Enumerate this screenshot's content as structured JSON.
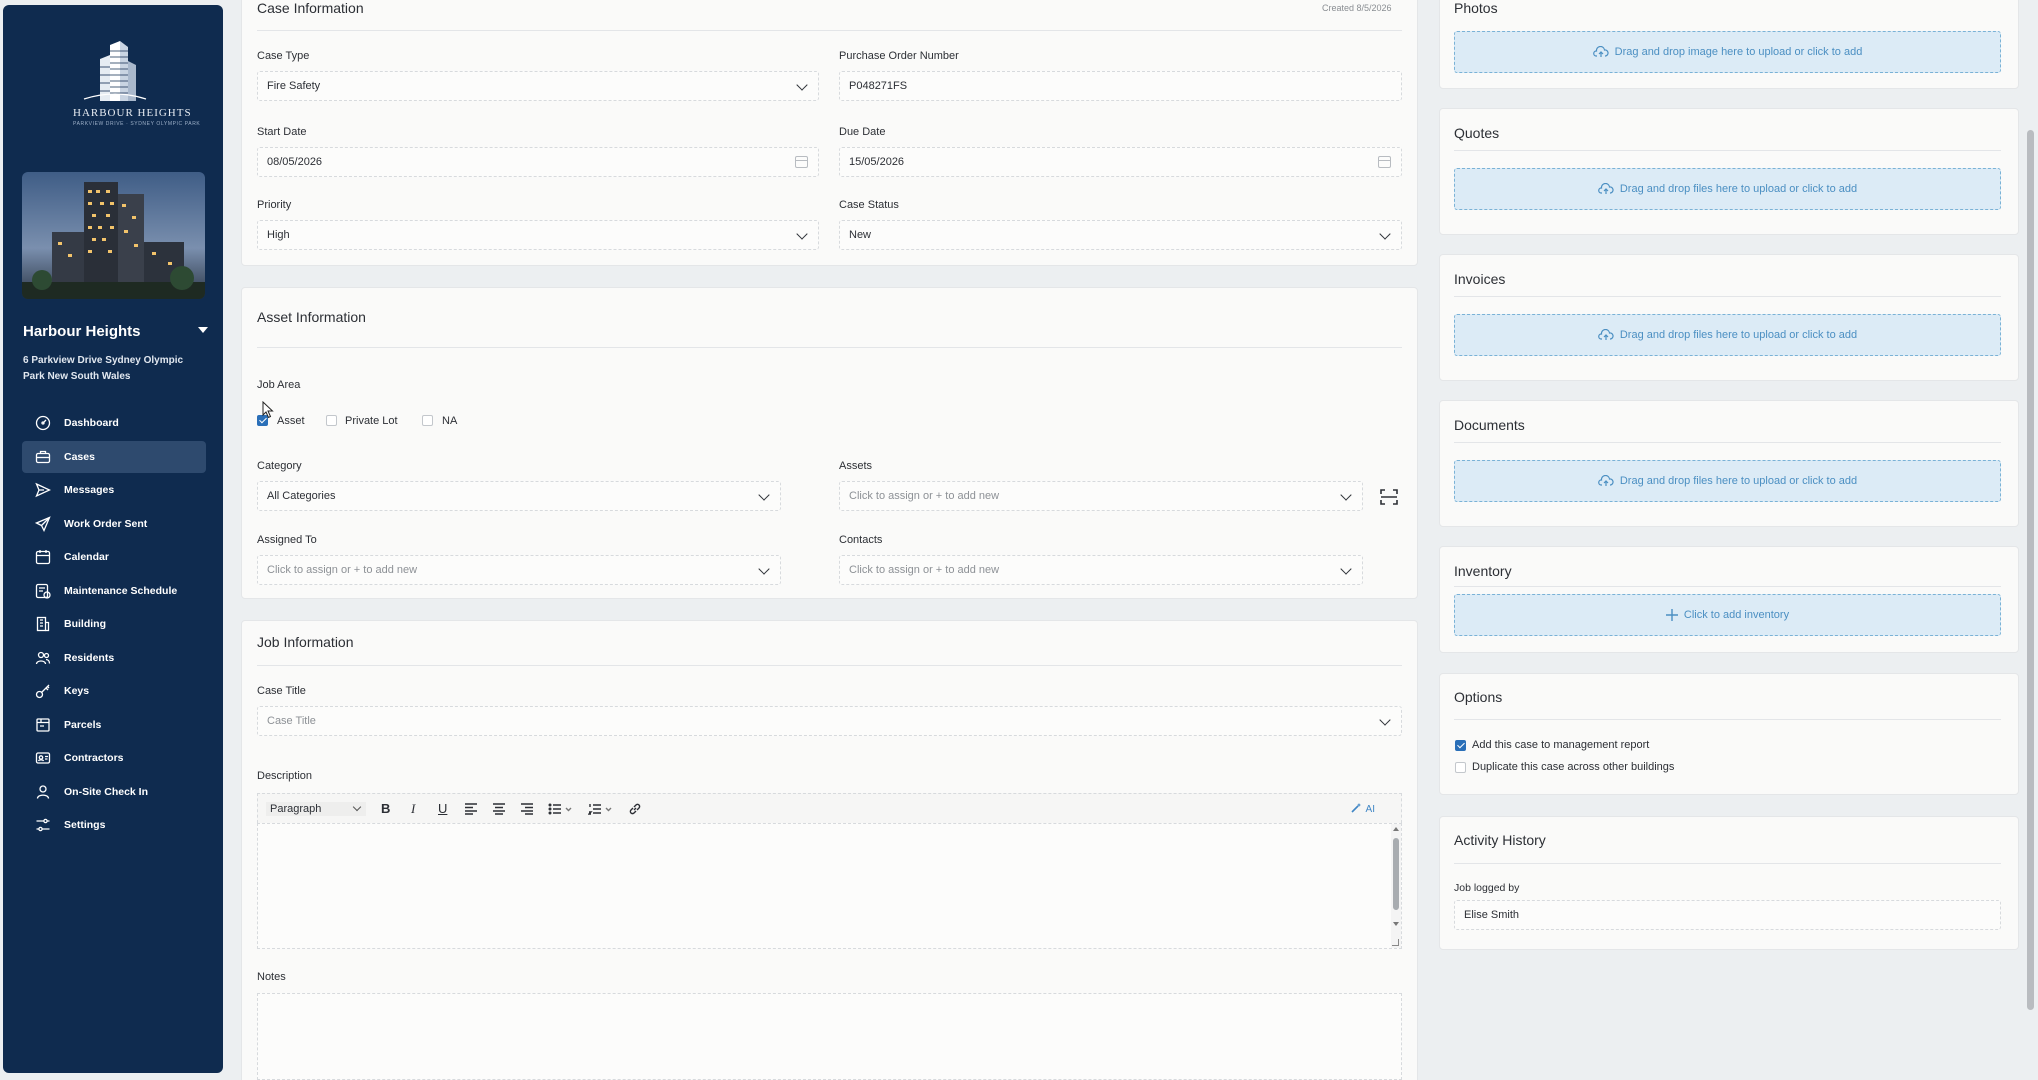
{
  "sidebar": {
    "logo_title": "HARBOUR HEIGHTS",
    "logo_subtitle": "PARKVIEW DRIVE · SYDNEY OLYMPIC PARK",
    "building_name": "Harbour Heights",
    "address": "6 Parkview Drive Sydney Olympic Park New South Wales",
    "nav": [
      {
        "label": "Dashboard",
        "icon": "dashboard-icon"
      },
      {
        "label": "Cases",
        "icon": "briefcase-icon",
        "active": true
      },
      {
        "label": "Messages",
        "icon": "send-icon"
      },
      {
        "label": "Work Order Sent",
        "icon": "paper-plane-icon"
      },
      {
        "label": "Calendar",
        "icon": "calendar-icon"
      },
      {
        "label": "Maintenance Schedule",
        "icon": "schedule-icon"
      },
      {
        "label": "Building",
        "icon": "building-icon"
      },
      {
        "label": "Residents",
        "icon": "residents-icon"
      },
      {
        "label": "Keys",
        "icon": "key-icon"
      },
      {
        "label": "Parcels",
        "icon": "parcel-icon"
      },
      {
        "label": "Contractors",
        "icon": "contractor-icon"
      },
      {
        "label": "On-Site Check In",
        "icon": "check-in-icon"
      },
      {
        "label": "Settings",
        "icon": "settings-icon"
      }
    ]
  },
  "case_info": {
    "title": "Case Information",
    "created": "Created 8/5/2026",
    "case_type_label": "Case Type",
    "case_type": "Fire Safety",
    "po_label": "Purchase Order Number",
    "po": "P048271FS",
    "start_label": "Start Date",
    "start": "08/05/2026",
    "due_label": "Due Date",
    "due": "15/05/2026",
    "priority_label": "Priority",
    "priority": "High",
    "status_label": "Case Status",
    "status": "New"
  },
  "asset_info": {
    "title": "Asset Information",
    "job_area_label": "Job Area",
    "job_area_options": [
      {
        "label": "Asset",
        "checked": true
      },
      {
        "label": "Private Lot",
        "checked": false
      },
      {
        "label": "NA",
        "checked": false
      }
    ],
    "category_label": "Category",
    "category": "All Categories",
    "assets_label": "Assets",
    "assets_placeholder": "Click to assign or + to add new",
    "assigned_label": "Assigned To",
    "assigned_placeholder": "Click to assign or + to add new",
    "contacts_label": "Contacts",
    "contacts_placeholder": "Click to assign or + to add new"
  },
  "job_info": {
    "title": "Job Information",
    "case_title_label": "Case Title",
    "case_title_placeholder": "Case Title",
    "description_label": "Description",
    "paragraph_select": "Paragraph",
    "ai_label": "AI",
    "notes_label": "Notes"
  },
  "right": {
    "photos_title": "Photos",
    "photos_upload": "Drag and drop image here to upload or click to add",
    "quotes_title": "Quotes",
    "quotes_upload": "Drag and drop files here to upload or click to add",
    "invoices_title": "Invoices",
    "invoices_upload": "Drag and drop files here to upload or click to add",
    "documents_title": "Documents",
    "documents_upload": "Drag and drop files here to upload or click to add",
    "inventory_title": "Inventory",
    "inventory_add": "Click to add inventory",
    "options_title": "Options",
    "option_report": "Add this case to management report",
    "option_report_checked": true,
    "option_duplicate": "Duplicate this case across other buildings",
    "option_duplicate_checked": false,
    "activity_title": "Activity History",
    "logged_by_label": "Job logged by",
    "logged_by": "Elise Smith"
  },
  "colors": {
    "sidebar_bg": "#0f2b4f",
    "accent": "#2a6fb8",
    "upload_bg": "#dcebf6",
    "upload_text": "#4b8fc2"
  }
}
